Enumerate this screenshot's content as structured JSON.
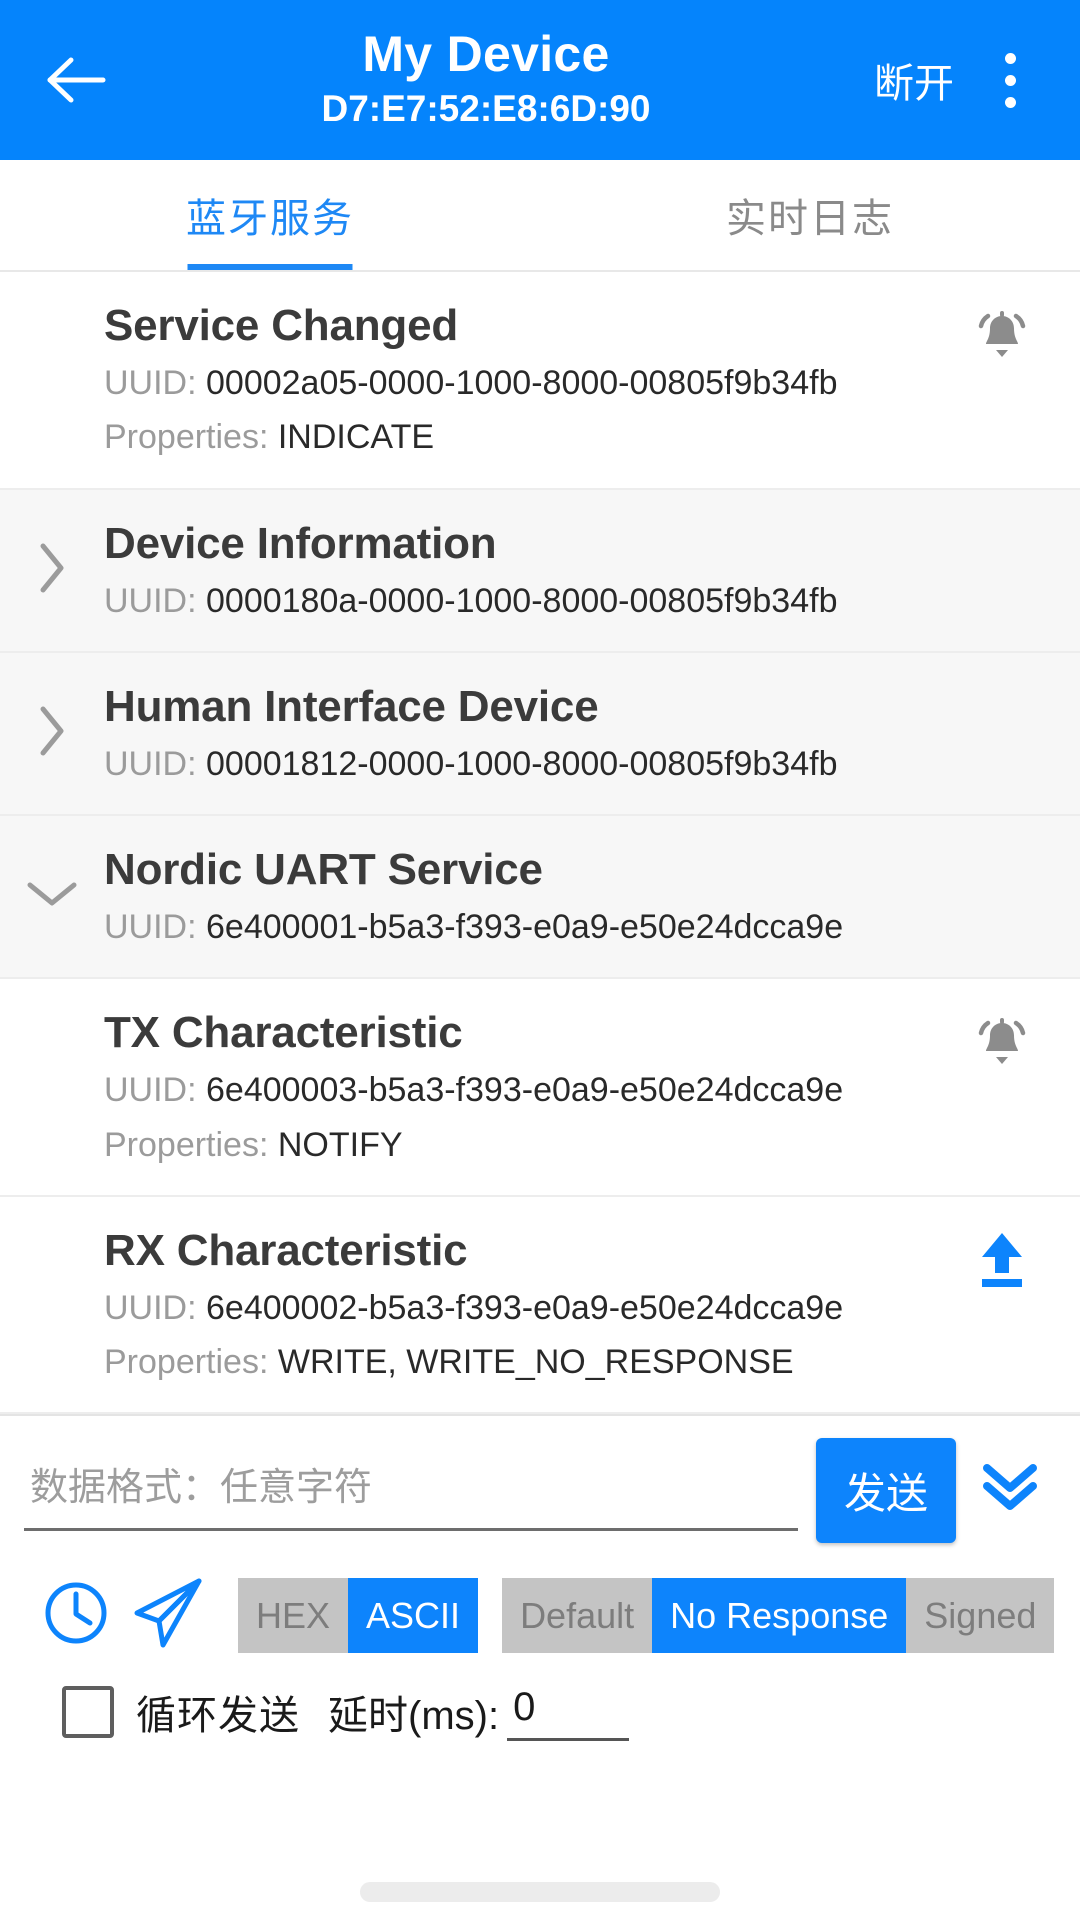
{
  "appbar": {
    "back_icon": "arrow-left-icon",
    "title": "My Device",
    "subtitle": "D7:E7:52:E8:6D:90",
    "disconnect_label": "断开",
    "overflow_icon": "more-vertical-icon",
    "background_color": "#0584fc"
  },
  "tabs": {
    "items": [
      {
        "label": "蓝牙服务",
        "active": true
      },
      {
        "label": "实时日志",
        "active": false
      }
    ],
    "active_color": "#1e88f5",
    "inactive_color": "#8a8a8a"
  },
  "labels": {
    "uuid": "UUID:",
    "properties": "Properties:"
  },
  "list": [
    {
      "kind": "characteristic",
      "title": "Service Changed",
      "uuid": "00002a05-0000-1000-8000-00805f9b34fb",
      "properties": "INDICATE",
      "action_icon": "bell-notification-icon",
      "action_color": "#8c8c8c"
    },
    {
      "kind": "service",
      "title": "Device Information",
      "uuid": "0000180a-0000-1000-8000-00805f9b34fb",
      "properties": "",
      "chevron_icon": "chevron-right-icon",
      "expanded": false
    },
    {
      "kind": "service",
      "title": "Human Interface Device",
      "uuid": "00001812-0000-1000-8000-00805f9b34fb",
      "properties": "",
      "chevron_icon": "chevron-right-icon",
      "expanded": false
    },
    {
      "kind": "service",
      "title": "Nordic UART Service",
      "uuid": "6e400001-b5a3-f393-e0a9-e50e24dcca9e",
      "properties": "",
      "chevron_icon": "chevron-down-icon",
      "expanded": true
    },
    {
      "kind": "characteristic",
      "title": "TX Characteristic",
      "uuid": "6e400003-b5a3-f393-e0a9-e50e24dcca9e",
      "properties": "NOTIFY",
      "action_icon": "bell-notification-icon",
      "action_color": "#8c8c8c"
    },
    {
      "kind": "characteristic",
      "title": "RX Characteristic",
      "uuid": "6e400002-b5a3-f393-e0a9-e50e24dcca9e",
      "properties": "WRITE, WRITE_NO_RESPONSE",
      "action_icon": "upload-arrow-icon",
      "action_color": "#0d84fc"
    }
  ],
  "composer": {
    "input_value": "",
    "input_placeholder": "数据格式：任意字符",
    "send_label": "发送",
    "expand_icon": "double-chevron-down-icon",
    "history_icon": "clock-icon",
    "quick_send_icon": "paper-plane-icon",
    "format_options": [
      {
        "label": "HEX",
        "selected": false
      },
      {
        "label": "ASCII",
        "selected": true
      }
    ],
    "write_options": [
      {
        "label": "Default",
        "selected": false
      },
      {
        "label": "No Response",
        "selected": true
      },
      {
        "label": "Signed",
        "selected": false
      }
    ],
    "loop_checkbox_label": "循环发送",
    "loop_checked": false,
    "delay_label": "延时(ms):",
    "delay_value": "0",
    "accent_color": "#0d84fc",
    "segment_inactive_color": "#c4c4c4"
  }
}
